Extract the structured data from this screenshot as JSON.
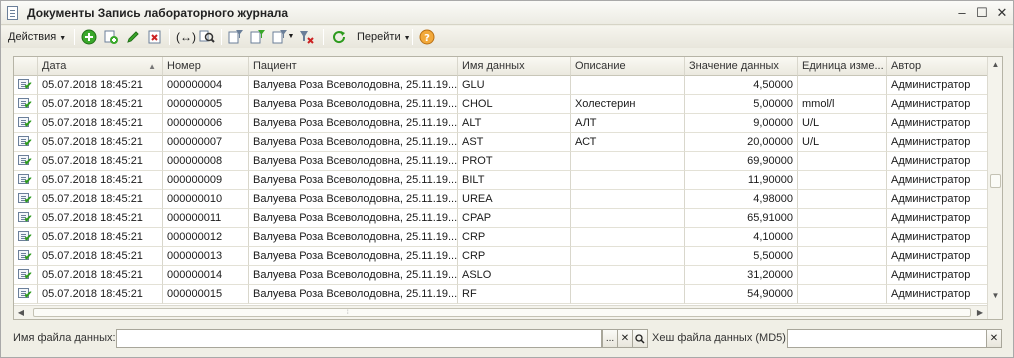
{
  "window": {
    "title": "Документы Запись лабораторного журнала"
  },
  "toolbar": {
    "actions_label": "Действия",
    "goto_label": "Перейти"
  },
  "grid": {
    "columns": [
      "Дата",
      "Номер",
      "Пациент",
      "Имя данных",
      "Описание",
      "Значение данных",
      "Единица изме...",
      "Автор"
    ],
    "rows": [
      {
        "date": "05.07.2018 18:45:21",
        "number": "000000004",
        "patient": "Валуева Роза Всеволодовна, 25.11.19...",
        "name": "GLU",
        "desc": "",
        "value": "4,50000",
        "unit": "",
        "author": "Администратор"
      },
      {
        "date": "05.07.2018 18:45:21",
        "number": "000000005",
        "patient": "Валуева Роза Всеволодовна, 25.11.19...",
        "name": "CHOL",
        "desc": "Холестерин",
        "value": "5,00000",
        "unit": "mmol/l",
        "author": "Администратор"
      },
      {
        "date": "05.07.2018 18:45:21",
        "number": "000000006",
        "patient": "Валуева Роза Всеволодовна, 25.11.19...",
        "name": "ALT",
        "desc": "АЛТ",
        "value": "9,00000",
        "unit": "U/L",
        "author": "Администратор"
      },
      {
        "date": "05.07.2018 18:45:21",
        "number": "000000007",
        "patient": "Валуева Роза Всеволодовна, 25.11.19...",
        "name": "AST",
        "desc": "АСТ",
        "value": "20,00000",
        "unit": "U/L",
        "author": "Администратор"
      },
      {
        "date": "05.07.2018 18:45:21",
        "number": "000000008",
        "patient": "Валуева Роза Всеволодовна, 25.11.19...",
        "name": "PROT",
        "desc": "",
        "value": "69,90000",
        "unit": "",
        "author": "Администратор"
      },
      {
        "date": "05.07.2018 18:45:21",
        "number": "000000009",
        "patient": "Валуева Роза Всеволодовна, 25.11.19...",
        "name": "BILT",
        "desc": "",
        "value": "11,90000",
        "unit": "",
        "author": "Администратор"
      },
      {
        "date": "05.07.2018 18:45:21",
        "number": "000000010",
        "patient": "Валуева Роза Всеволодовна, 25.11.19...",
        "name": "UREA",
        "desc": "",
        "value": "4,98000",
        "unit": "",
        "author": "Администратор"
      },
      {
        "date": "05.07.2018 18:45:21",
        "number": "000000011",
        "patient": "Валуева Роза Всеволодовна, 25.11.19...",
        "name": "CPAP",
        "desc": "",
        "value": "65,91000",
        "unit": "",
        "author": "Администратор"
      },
      {
        "date": "05.07.2018 18:45:21",
        "number": "000000012",
        "patient": "Валуева Роза Всеволодовна, 25.11.19...",
        "name": "CRP",
        "desc": "",
        "value": "4,10000",
        "unit": "",
        "author": "Администратор"
      },
      {
        "date": "05.07.2018 18:45:21",
        "number": "000000013",
        "patient": "Валуева Роза Всеволодовна, 25.11.19...",
        "name": "CRP",
        "desc": "",
        "value": "5,50000",
        "unit": "",
        "author": "Администратор"
      },
      {
        "date": "05.07.2018 18:45:21",
        "number": "000000014",
        "patient": "Валуева Роза Всеволодовна, 25.11.19...",
        "name": "ASLO",
        "desc": "",
        "value": "31,20000",
        "unit": "",
        "author": "Администратор"
      },
      {
        "date": "05.07.2018 18:45:21",
        "number": "000000015",
        "patient": "Валуева Роза Всеволодовна, 25.11.19...",
        "name": "RF",
        "desc": "",
        "value": "54,90000",
        "unit": "",
        "author": "Администратор"
      }
    ]
  },
  "footer": {
    "data_file_label": "Имя файла данных:",
    "data_file_value": "",
    "hash_label": "Хеш файла данных (MD5):",
    "hash_value": ""
  },
  "colors": {
    "accent_green": "#2d9a1d",
    "delete_red": "#cc2222"
  }
}
